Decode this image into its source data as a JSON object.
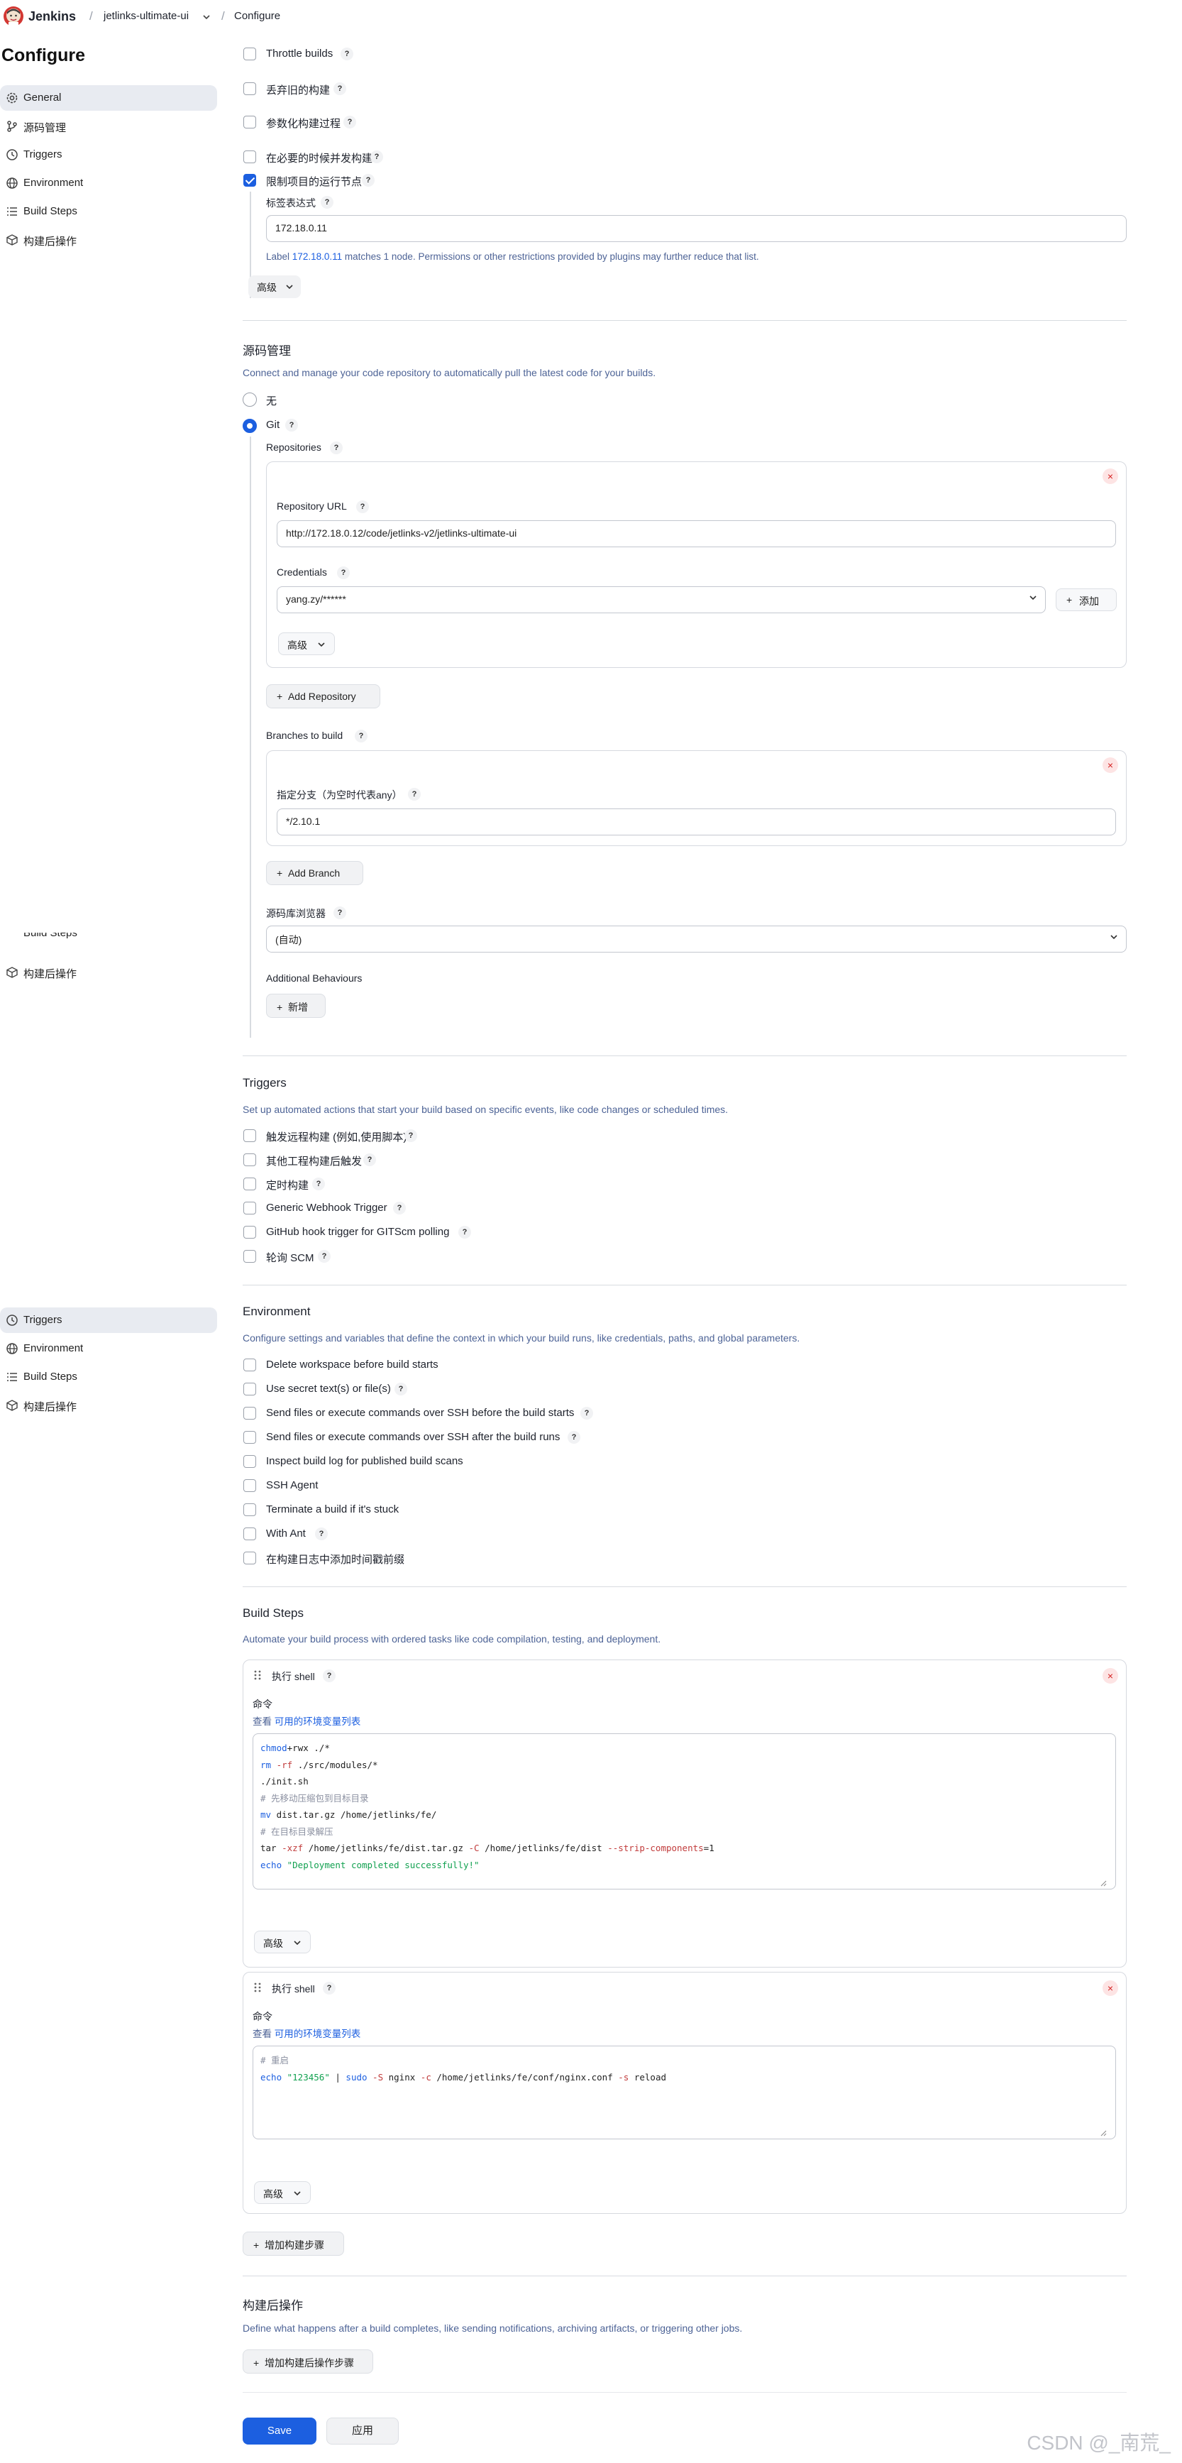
{
  "header": {
    "app_name": "Jenkins",
    "job_name": "jetlinks-ultimate-ui",
    "page": "Configure",
    "sep": "/"
  },
  "sidebar": {
    "title": "Configure",
    "items": [
      {
        "label": "General",
        "icon": "gear-icon"
      },
      {
        "label": "源码管理",
        "icon": "branch-icon"
      },
      {
        "label": "Triggers",
        "icon": "clock-icon"
      },
      {
        "label": "Environment",
        "icon": "globe-icon"
      },
      {
        "label": "Build Steps",
        "icon": "list-icon"
      },
      {
        "label": "构建后操作",
        "icon": "box-icon"
      }
    ],
    "ghost_items": [
      "Build Steps",
      "构建后操作"
    ]
  },
  "general": {
    "options": [
      {
        "label": "Throttle builds",
        "checked": false
      },
      {
        "label": "丢弃旧的构建",
        "checked": false
      },
      {
        "label": "参数化构建过程",
        "checked": false
      },
      {
        "label": "在必要的时候并发构建",
        "checked": false
      },
      {
        "label": "限制项目的运行节点",
        "checked": true
      }
    ],
    "label_expr_title": "标签表达式",
    "label_expr_value": "172.18.0.11",
    "label_hint_prefix": "Label ",
    "label_hint_link": "172.18.0.11",
    "label_hint_suffix": " matches 1 node. Permissions or other restrictions provided by plugins may further reduce that list.",
    "advanced": "高级"
  },
  "scm": {
    "title": "源码管理",
    "description": "Connect and manage your code repository to automatically pull the latest code for your builds.",
    "option_none": "无",
    "option_git": "Git",
    "repositories_title": "Repositories",
    "repo_url_label": "Repository URL",
    "repo_url_value": "http://172.18.0.12/code/jetlinks-v2/jetlinks-ultimate-ui",
    "credentials_label": "Credentials",
    "credentials_value": "yang.zy/******",
    "add_credentials": "添加",
    "advanced": "高级",
    "add_repository": "Add Repository",
    "branches_title": "Branches to build",
    "branch_spec_label": "指定分支（为空时代表any）",
    "branch_spec_value": "*/2.10.1",
    "add_branch": "Add Branch",
    "browser_label": "源码库浏览器",
    "browser_value": "(自动)",
    "behaviours_title": "Additional Behaviours",
    "add_behaviour": "新增"
  },
  "triggers": {
    "title": "Triggers",
    "description": "Set up automated actions that start your build based on specific events, like code changes or scheduled times.",
    "options": [
      {
        "label": "触发远程构建 (例如,使用脚本)",
        "checked": false
      },
      {
        "label": "其他工程构建后触发",
        "checked": false
      },
      {
        "label": "定时构建",
        "checked": false
      },
      {
        "label": "Generic Webhook Trigger",
        "checked": false
      },
      {
        "label": "GitHub hook trigger for GITScm polling",
        "checked": false
      },
      {
        "label": "轮询 SCM",
        "checked": false
      }
    ]
  },
  "environment": {
    "title": "Environment",
    "description": "Configure settings and variables that define the context in which your build runs, like credentials, paths, and global parameters.",
    "options": [
      {
        "label": "Delete workspace before build starts",
        "checked": false
      },
      {
        "label": "Use secret text(s) or file(s)",
        "checked": false
      },
      {
        "label": "Send files or execute commands over SSH before the build starts",
        "checked": false
      },
      {
        "label": "Send files or execute commands over SSH after the build runs",
        "checked": false
      },
      {
        "label": "Inspect build log for published build scans",
        "checked": false
      },
      {
        "label": "SSH Agent",
        "checked": false
      },
      {
        "label": "Terminate a build if it's stuck",
        "checked": false
      },
      {
        "label": "With Ant",
        "checked": false
      },
      {
        "label": "在构建日志中添加时间戳前缀",
        "checked": false
      }
    ]
  },
  "build_steps": {
    "title": "Build Steps",
    "description": "Automate your build process with ordered tasks like code compilation, testing, and deployment.",
    "steps": [
      {
        "title": "执行 shell",
        "command_label": "命令",
        "env_link_prefix": "查看 ",
        "env_link": "可用的环境变量列表",
        "advanced": "高级",
        "lines": [
          [
            [
              "kw",
              "chmod"
            ],
            [
              "",
              "+rwx ./*"
            ]
          ],
          [
            [
              "kw",
              "rm"
            ],
            [
              "fl",
              " -rf"
            ],
            [
              "",
              " ./src/modules/*"
            ]
          ],
          [
            [
              "",
              "./init.sh"
            ]
          ],
          [
            [
              "cm",
              "# 先移动压缩包到目标目录"
            ]
          ],
          [
            [
              "kw",
              "mv"
            ],
            [
              "",
              " dist.tar.gz /home/jetlinks/fe/"
            ]
          ],
          [
            [
              "cm",
              "# 在目标目录解压"
            ]
          ],
          [
            [
              "",
              "tar "
            ],
            [
              "fl",
              "-xzf"
            ],
            [
              "",
              " /home/jetlinks/fe/dist.tar.gz "
            ],
            [
              "fl",
              "-C"
            ],
            [
              "",
              " /home/jetlinks/fe/dist "
            ],
            [
              "fl",
              "--strip-components"
            ],
            [
              "",
              "=1"
            ]
          ],
          [
            [
              "kw",
              "echo"
            ],
            [
              "str",
              " \"Deployment completed successfully!\""
            ]
          ]
        ]
      },
      {
        "title": "执行 shell",
        "command_label": "命令",
        "env_link_prefix": "查看 ",
        "env_link": "可用的环境变量列表",
        "advanced": "高级",
        "lines": [
          [
            [
              "cm",
              "# 重启"
            ]
          ],
          [
            [
              "kw",
              "echo"
            ],
            [
              "str",
              " \"123456\""
            ],
            [
              "",
              " | "
            ],
            [
              "kw",
              "sudo"
            ],
            [
              "fl",
              " -S"
            ],
            [
              "",
              " nginx "
            ],
            [
              "fl",
              "-c"
            ],
            [
              "",
              " /home/jetlinks/fe/conf/nginx.conf "
            ],
            [
              "fl",
              "-s"
            ],
            [
              "",
              " reload"
            ]
          ]
        ]
      }
    ],
    "add_step": "增加构建步骤"
  },
  "post_build": {
    "title": "构建后操作",
    "description": "Define what happens after a build completes, like sending notifications, archiving artifacts, or triggering other jobs.",
    "add_step": "增加构建后操作步骤"
  },
  "footer": {
    "save": "Save",
    "apply": "应用",
    "watermark": "CSDN @_南荒_"
  },
  "colors": {
    "accent": "#1c5fe0",
    "description": "#4d6396",
    "danger": "#d42222"
  }
}
